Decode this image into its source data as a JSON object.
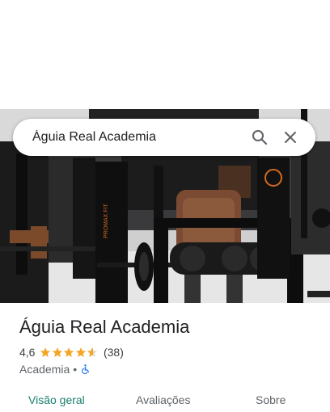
{
  "search": {
    "query": "Águia Real Academia"
  },
  "place": {
    "name": "Águia Real Academia",
    "rating": "4,6",
    "rating_value": 4.6,
    "review_count": "(38)",
    "category": "Academia",
    "separator": "•",
    "wheelchair_icon": "wheelchair-accessible-icon"
  },
  "photo": {
    "equipment_brand_text": "PROMAX FIT"
  },
  "tabs": [
    {
      "label": "Visão geral",
      "active": true
    },
    {
      "label": "Avaliações",
      "active": false
    },
    {
      "label": "Sobre",
      "active": false
    }
  ],
  "colors": {
    "accent": "#1a7f6e",
    "star": "#f4a623"
  }
}
